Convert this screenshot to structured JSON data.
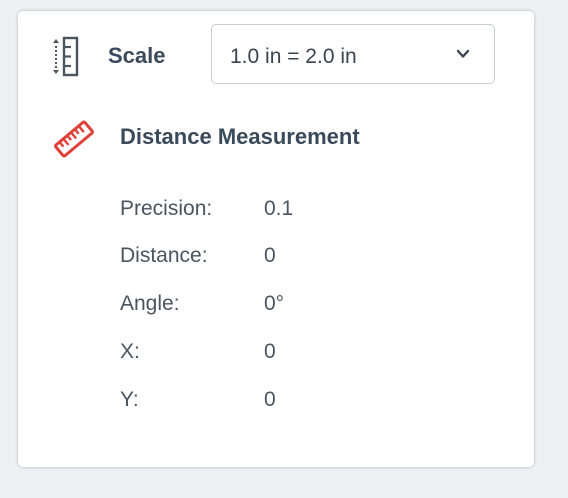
{
  "scale": {
    "label": "Scale",
    "selected": "1.0 in = 2.0 in",
    "icon": "ruler-vertical-icon"
  },
  "measurement": {
    "icon": "ruler-icon",
    "icon_color": "#e0403a",
    "title": "Distance Measurement",
    "rows": [
      {
        "label": "Precision:",
        "value": "0.1"
      },
      {
        "label": "Distance:",
        "value": "0"
      },
      {
        "label": "Angle:",
        "value": "0°"
      },
      {
        "label": "X:",
        "value": "0"
      },
      {
        "label": "Y:",
        "value": "0"
      }
    ]
  }
}
